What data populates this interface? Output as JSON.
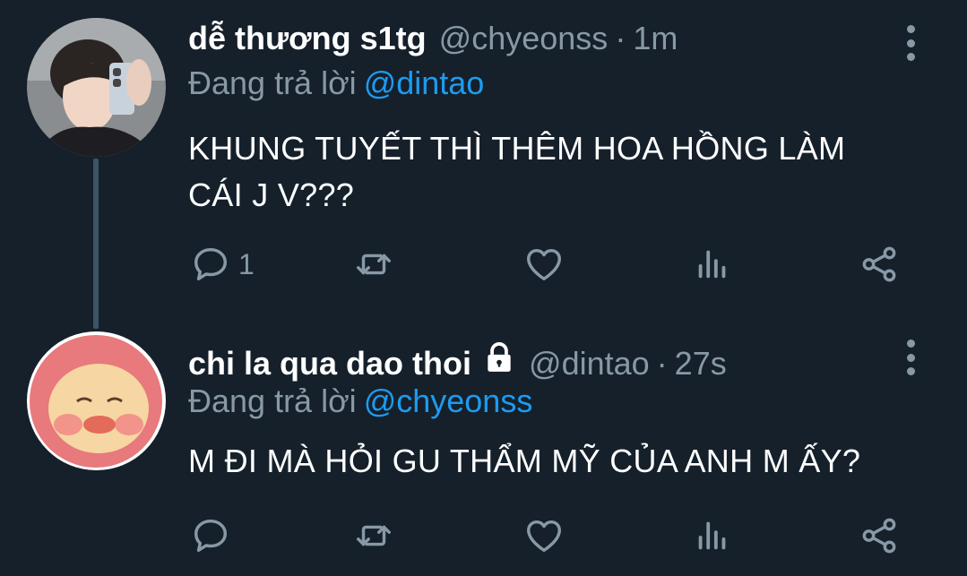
{
  "tweets": [
    {
      "display_name": "dễ thương s1tg",
      "handle": "@chyeonss",
      "separator": "·",
      "time": "1m",
      "reply_prefix": "Đang trả lời",
      "reply_to": "@dintao",
      "text": "KHUNG TUYẾT THÌ THÊM HOA HỒNG LÀM CÁI J V???",
      "reply_count": "1",
      "locked": false
    },
    {
      "display_name": "chi la qua dao thoi",
      "handle": "@dintao",
      "separator": "·",
      "time": "27s",
      "reply_prefix": "Đang trả lời",
      "reply_to": "@chyeonss",
      "text": "M ĐI MÀ HỎI GU THẨM MỸ CỦA ANH M ẤY?",
      "reply_count": "",
      "locked": true
    }
  ],
  "icons": {
    "reply": "reply-icon",
    "retweet": "retweet-icon",
    "like": "heart-icon",
    "analytics": "analytics-icon",
    "share": "share-icon",
    "menu": "more-vertical-icon",
    "lock": "lock-icon"
  },
  "colors": {
    "background": "#15202b",
    "secondary_text": "#8899a6",
    "link": "#1d9bf0",
    "thread_line": "#3d5466"
  }
}
